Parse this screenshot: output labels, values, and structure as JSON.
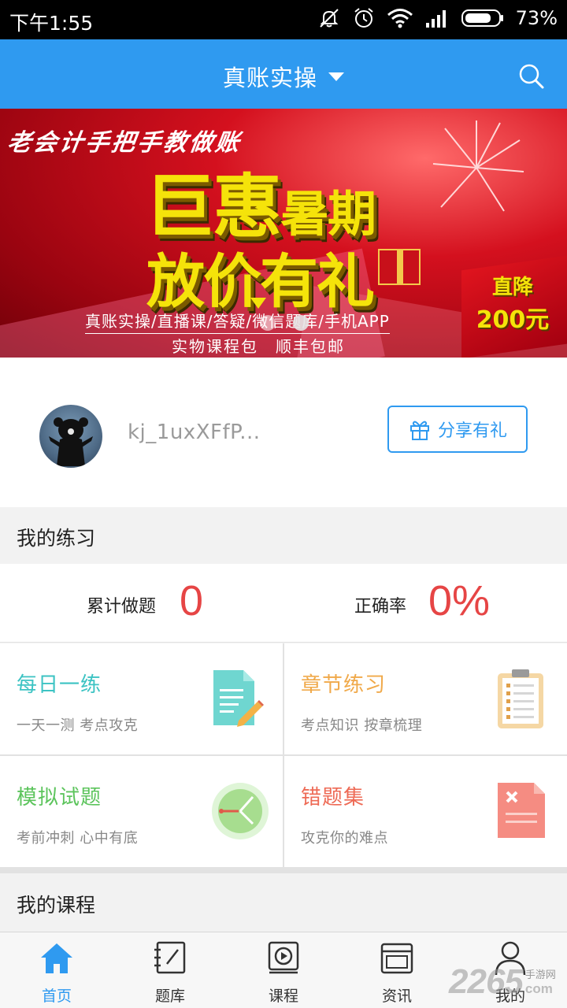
{
  "status_bar": {
    "time": "下午1:55",
    "battery": "73%",
    "icons": [
      "mute-icon",
      "alarm-icon",
      "wifi-icon",
      "signal-icon",
      "battery-icon"
    ]
  },
  "header": {
    "title": "真账实操",
    "icons": [
      "chevron-down-icon",
      "search-icon"
    ]
  },
  "banner": {
    "slogan": "老会计手把手教做账",
    "headline_main": "巨惠",
    "headline_small": "暑期",
    "headline_2": "放价有礼",
    "features": "真账实操/直播课/答疑/微信题库/手机APP",
    "bonus": "实物课程包　顺丰包邮",
    "ribbon_1": "直降",
    "ribbon_2": "200元",
    "active_slide": 2,
    "slide_count": 2
  },
  "profile": {
    "username": "kj_1uxXFfP...",
    "share_label": "分享有礼"
  },
  "practice": {
    "section_title": "我的练习",
    "total_label": "累计做题",
    "total_value": "0",
    "accuracy_label": "正确率",
    "accuracy_value": "0%",
    "cards": [
      {
        "title": "每日一练",
        "subtitle": "一天一测 考点攻克",
        "color": "#3cc3c3",
        "icon": "document-edit-icon"
      },
      {
        "title": "章节练习",
        "subtitle": "考点知识 按章梳理",
        "color": "#f0a94a",
        "icon": "clipboard-list-icon"
      },
      {
        "title": "模拟试题",
        "subtitle": "考前冲刺 心中有底",
        "color": "#5cc45c",
        "icon": "clock-exam-icon"
      },
      {
        "title": "错题集",
        "subtitle": "攻克你的难点",
        "color": "#ee6a55",
        "icon": "wrong-answer-icon"
      }
    ]
  },
  "courses": {
    "section_title": "我的课程"
  },
  "bottom_nav": {
    "items": [
      {
        "label": "首页",
        "icon": "home-icon",
        "active": true
      },
      {
        "label": "题库",
        "icon": "question-bank-icon",
        "active": false
      },
      {
        "label": "课程",
        "icon": "play-course-icon",
        "active": false
      },
      {
        "label": "资讯",
        "icon": "news-icon",
        "active": false
      },
      {
        "label": "我的",
        "icon": "user-icon",
        "active": false
      }
    ]
  },
  "watermark": {
    "number": "2265",
    "cn": "手游网",
    "en": "com"
  },
  "colors": {
    "primary": "#2f9af0",
    "accent_red": "#e64545"
  }
}
